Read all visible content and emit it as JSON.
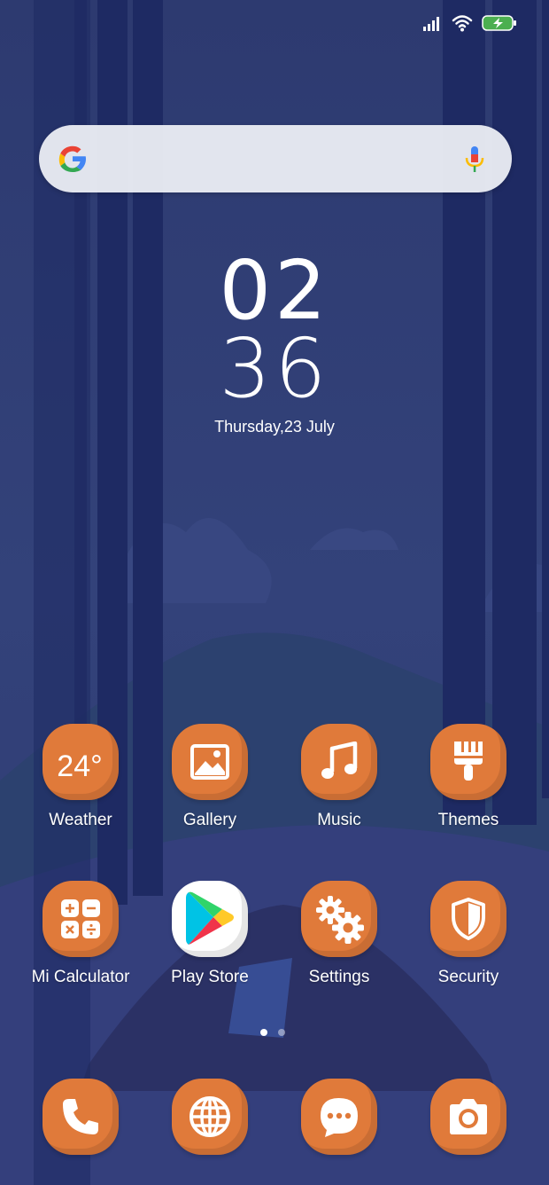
{
  "status_bar": {
    "signal_icon": "signal-bars-icon",
    "wifi_icon": "wifi-icon",
    "battery_icon": "battery-charging-icon"
  },
  "search": {
    "logo": "google-logo",
    "mic_icon": "microphone-icon"
  },
  "clock": {
    "hour": "02",
    "minute": "36",
    "date": "Thursday,23 July"
  },
  "apps": [
    {
      "label": "Weather",
      "icon": "weather-icon",
      "temp": "24°"
    },
    {
      "label": "Gallery",
      "icon": "image-icon"
    },
    {
      "label": "Music",
      "icon": "music-note-icon"
    },
    {
      "label": "Themes",
      "icon": "paint-brush-icon"
    },
    {
      "label": "Mi Calculator",
      "icon": "calculator-icon"
    },
    {
      "label": "Play Store",
      "icon": "play-store-icon"
    },
    {
      "label": "Settings",
      "icon": "gears-icon"
    },
    {
      "label": "Security",
      "icon": "shield-icon"
    }
  ],
  "dock": [
    {
      "icon": "phone-icon"
    },
    {
      "icon": "globe-icon"
    },
    {
      "icon": "chat-bubble-icon"
    },
    {
      "icon": "camera-icon"
    }
  ],
  "pages": {
    "count": 2,
    "current": 1
  },
  "colors": {
    "background": "#2e3b72",
    "icon_orange": "#e07a3a",
    "tree": "#1e2a63"
  }
}
